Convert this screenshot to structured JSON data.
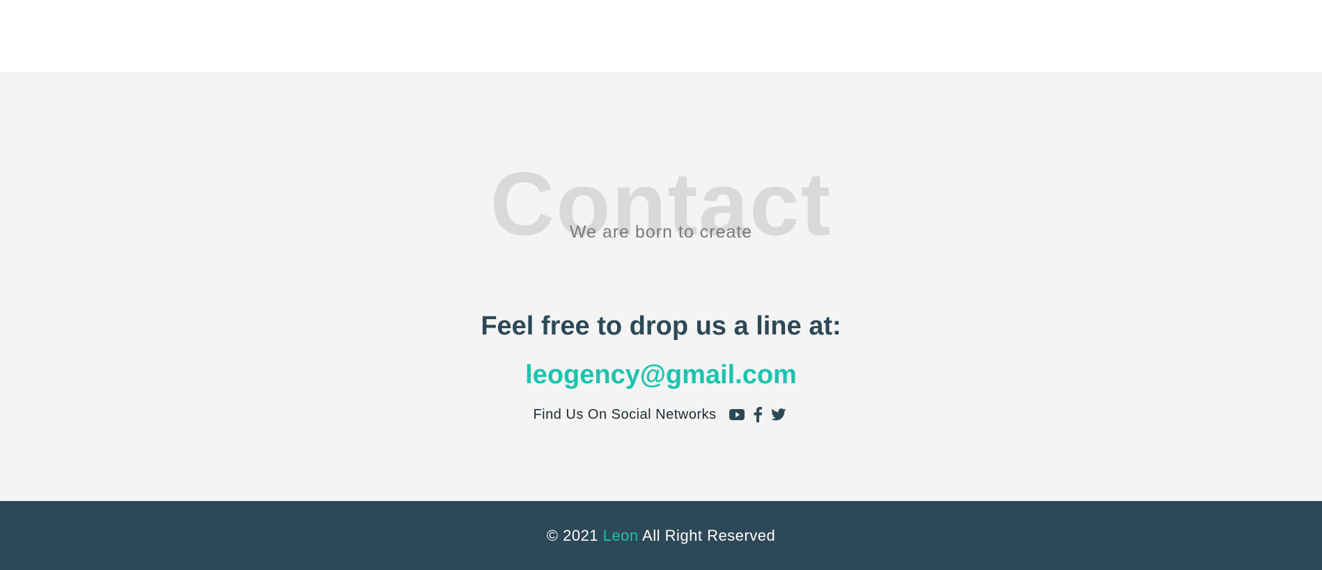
{
  "contact": {
    "background_title": "Contact",
    "subtitle": "We are born to create",
    "heading": "Feel free to drop us a line at:",
    "email": "leogency@gmail.com",
    "social_label": "Find Us On Social Networks",
    "social_icons": [
      "youtube-icon",
      "facebook-icon",
      "twitter-icon"
    ]
  },
  "footer": {
    "prefix": "© 2021",
    "brand": "Leon",
    "suffix": "All Right Reserved"
  },
  "colors": {
    "accent": "#1bc4af",
    "dark": "#2d4856",
    "section_bg": "#f4f4f4"
  }
}
